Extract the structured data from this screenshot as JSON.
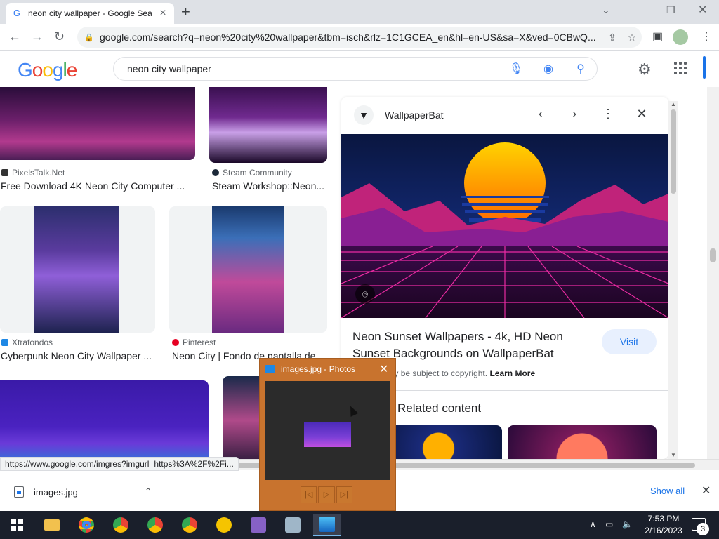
{
  "browser": {
    "tab_title": "neon city wallpaper - Google Sea",
    "favicon": "G",
    "url": "google.com/search?q=neon%20city%20wallpaper&tbm=isch&rlz=1C1GCEA_en&hl=en-US&sa=X&ved=0CBwQ..."
  },
  "google": {
    "logo": {
      "letters": [
        "G",
        "o",
        "o",
        "g",
        "l",
        "e"
      ],
      "colors": [
        "#4285f4",
        "#ea4335",
        "#fbbc05",
        "#4285f4",
        "#34a853",
        "#ea4335"
      ]
    },
    "query": "neon city wallpaper"
  },
  "results": [
    {
      "source": "PixelsTalk.Net",
      "caption": "Free Download 4K Neon City Computer ..."
    },
    {
      "source": "Steam Community",
      "caption": "Steam Workshop::Neon..."
    },
    {
      "source": "Xtrafondos",
      "caption": "Cyberpunk Neon City Wallpaper ..."
    },
    {
      "source": "Pinterest",
      "caption": "Neon City | Fondo de pantalla de ..."
    }
  ],
  "panel": {
    "site_name": "WallpaperBat",
    "title": "Neon Sunset Wallpapers - 4k, HD Neon Sunset Backgrounds on WallpaperBat",
    "visit_label": "Visit",
    "copyright_text": "Images may be subject to copyright.",
    "learn_more": "Learn More",
    "related_heading": "Related content"
  },
  "status_url": "https://www.google.com/imgres?imgurl=https%3A%2F%2Fi...",
  "downloads": {
    "file_name": "images.jpg",
    "show_all": "Show all"
  },
  "photos_popup": {
    "title": "images.jpg - Photos"
  },
  "taskbar": {
    "time": "7:53 PM",
    "date": "2/16/2023",
    "notification_count": "3"
  }
}
